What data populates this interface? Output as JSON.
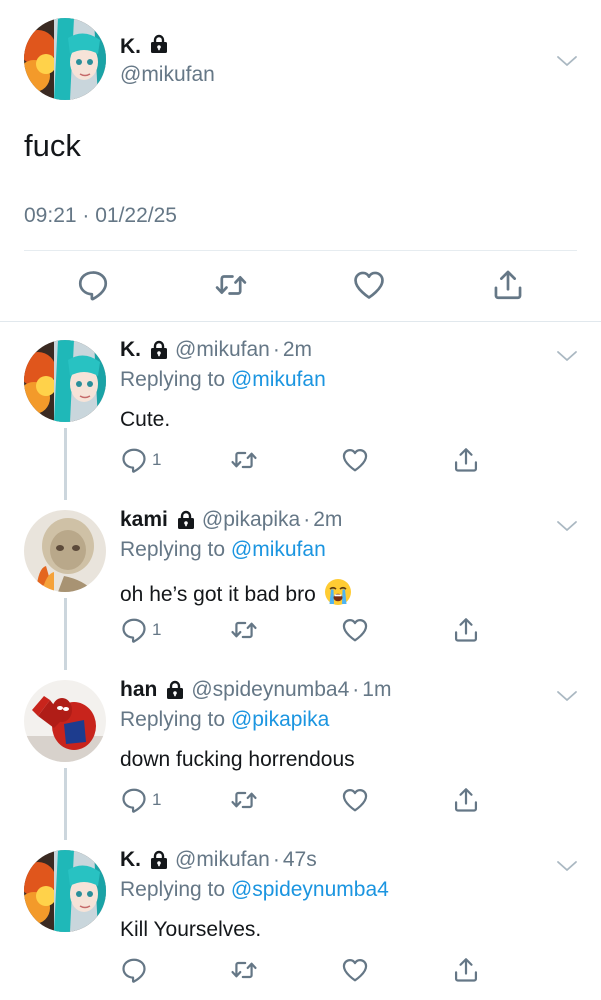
{
  "main_tweet": {
    "name": "K.",
    "handle": "@mikufan",
    "text": "fuck",
    "timestamp": "09:21 · 01/22/25"
  },
  "replies": [
    {
      "name": "K.",
      "handle": "@mikufan",
      "dot": "·",
      "age": "2m",
      "replying_prefix": "Replying to ",
      "replying_to": "@mikufan",
      "text": "Cute.",
      "emoji": "",
      "reply_count": "1",
      "avatar": "miku"
    },
    {
      "name": "kami",
      "handle": "@pikapika",
      "dot": "·",
      "age": "2m",
      "replying_prefix": "Replying to ",
      "replying_to": "@mikufan",
      "text": "oh he’s got it bad bro",
      "emoji": "loudly-crying-face",
      "reply_count": "1",
      "avatar": "pale-figure"
    },
    {
      "name": "han",
      "handle": "@spideynumba4",
      "dot": "·",
      "age": "1m",
      "replying_prefix": "Replying to ",
      "replying_to": "@pikapika",
      "text": "down fucking horrendous",
      "emoji": "",
      "reply_count": "1",
      "avatar": "spiderman"
    },
    {
      "name": "K.",
      "handle": "@mikufan",
      "dot": "·",
      "age": "47s",
      "replying_prefix": "Replying to ",
      "replying_to": "@spideynumba4",
      "text": "Kill Yourselves.",
      "emoji": "",
      "reply_count": "",
      "avatar": "miku"
    }
  ],
  "colors": {
    "link": "#1b95e0",
    "secondary_text": "#657786",
    "primary_text": "#14171a",
    "divider": "#e6ecf0"
  },
  "icons": [
    "lock-icon",
    "chevron-down-icon",
    "reply-icon",
    "retweet-icon",
    "like-icon",
    "share-icon"
  ]
}
